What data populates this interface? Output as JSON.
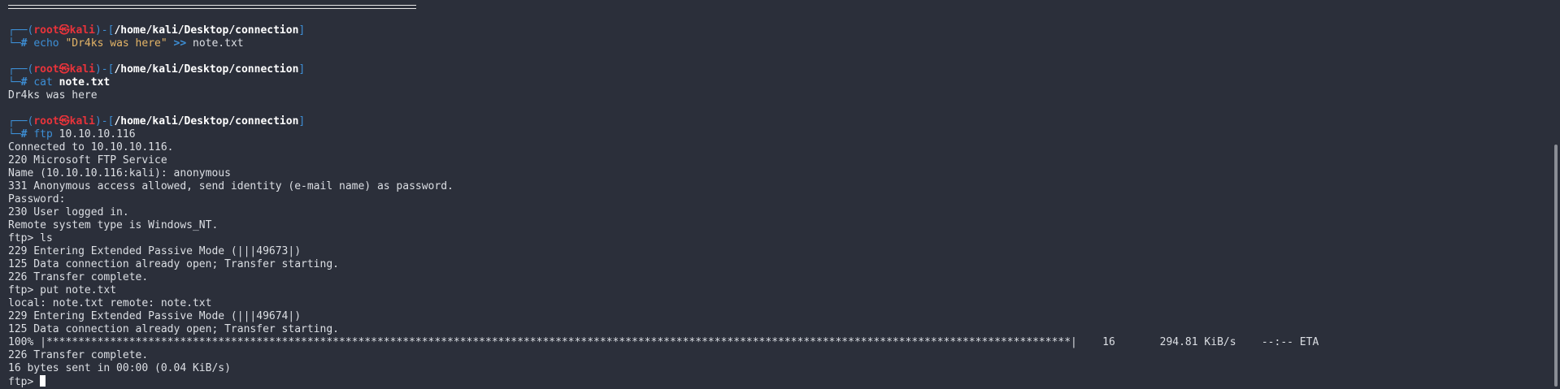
{
  "prompt": {
    "user": "root",
    "symbol": "㉿",
    "host": "kali",
    "cwd": "/home/kali/Desktop/connection",
    "top_prefix": "┌──(",
    "mid": ")-[",
    "top_suffix": "]",
    "bottom_prefix": "└─",
    "hash": "#"
  },
  "blocks": [
    {
      "command": "echo",
      "string_arg": "\"Dr4ks was here\"",
      "redirect": ">>",
      "target": "note.txt",
      "output": []
    },
    {
      "command": "cat",
      "target": "note.txt",
      "output": [
        "Dr4ks was here"
      ]
    },
    {
      "command": "ftp",
      "target": "10.10.10.116",
      "output": [
        "Connected to 10.10.10.116.",
        "220 Microsoft FTP Service",
        "Name (10.10.10.116:kali): anonymous",
        "331 Anonymous access allowed, send identity (e-mail name) as password.",
        "Password:",
        "230 User logged in.",
        "Remote system type is Windows_NT.",
        "ftp> ls",
        "229 Entering Extended Passive Mode (|||49673|)",
        "125 Data connection already open; Transfer starting.",
        "226 Transfer complete.",
        "ftp> put note.txt",
        "local: note.txt remote: note.txt",
        "229 Entering Extended Passive Mode (|||49674|)",
        "125 Data connection already open; Transfer starting.",
        "100% |*****************************************************************************************************************************************************************|    16       294.81 KiB/s    --:-- ETA",
        "226 Transfer complete.",
        "16 bytes sent in 00:00 (0.04 KiB/s)"
      ]
    }
  ],
  "final_prompt": "ftp> "
}
